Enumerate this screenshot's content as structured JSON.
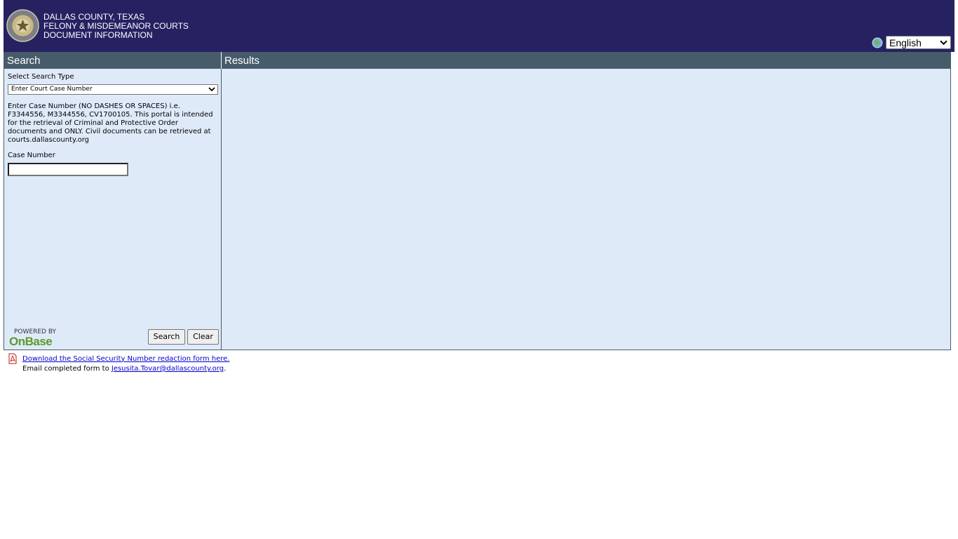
{
  "header": {
    "line1": "DALLAS COUNTY, TEXAS",
    "line2": "FELONY & MISDEMEANOR COURTS",
    "line3": "DOCUMENT INFORMATION",
    "language": "English"
  },
  "search": {
    "panel_title": "Search",
    "type_label": "Select Search Type",
    "type_selected": "Enter Court Case Number",
    "instructions": "Enter Case Number (NO DASHES OR SPACES) i.e. F3344556, M3344556, CV1700105. This portal is intended for the retrieval of Criminal and Protective Order documents and ONLY. Civil documents can be retrieved at courts.dallascounty.org",
    "case_label": "Case Number",
    "case_value": "",
    "search_button": "Search",
    "clear_button": "Clear",
    "powered_by": "POWERED BY",
    "powered_logo": "OnBase"
  },
  "results": {
    "panel_title": "Results"
  },
  "footer": {
    "download_link": "Download the Social Security Number redaction form here.",
    "email_prefix": "Email completed form to ",
    "email_link": "Jesusita.Tovar@dallascounty.org",
    "email_suffix": "."
  },
  "colors": {
    "header_bg": "#262262",
    "panel_head_bg": "#475c6b",
    "results_bg": "#dfeaf9",
    "link": "#0000cc",
    "onbase_green": "#5a9a2c"
  },
  "icons": {
    "seal": "county-seal-icon",
    "globe": "globe-icon",
    "pdf": "pdf-icon",
    "chevron": "chevron-down-icon"
  }
}
